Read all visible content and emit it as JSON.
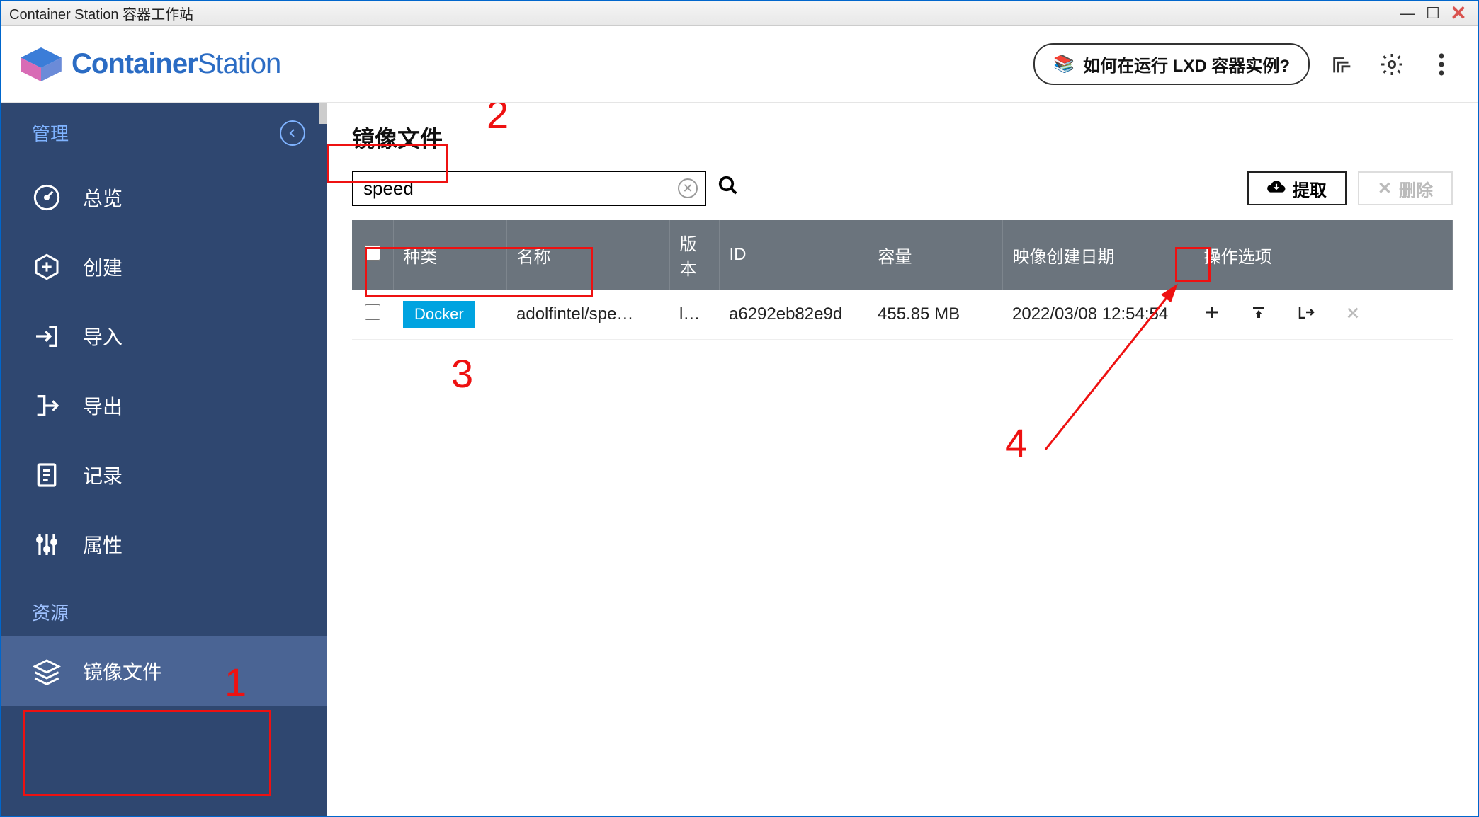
{
  "window": {
    "title": "Container Station 容器工作站"
  },
  "brand": {
    "name_bold": "Container",
    "name_thin": "Station"
  },
  "header": {
    "howto": "如何在运行 LXD 容器实例?"
  },
  "sidebar": {
    "section_manage": "管理",
    "section_resource": "资源",
    "items": {
      "overview": "总览",
      "create": "创建",
      "import": "导入",
      "export": "导出",
      "log": "记录",
      "properties": "属性",
      "images": "镜像文件"
    }
  },
  "page": {
    "title": "镜像文件"
  },
  "search": {
    "value": "speed"
  },
  "buttons": {
    "pull": "提取",
    "delete": "删除"
  },
  "table": {
    "headers": {
      "type": "种类",
      "name": "名称",
      "version": "版本",
      "id": "ID",
      "size": "容量",
      "created": "映像创建日期",
      "actions": "操作选项"
    },
    "rows": [
      {
        "type": "Docker",
        "name": "adolfintel/spe…",
        "version": "l…",
        "id": "a6292eb82e9d",
        "size": "455.85 MB",
        "created": "2022/03/08 12:54:54"
      }
    ]
  },
  "annotations": {
    "n1": "1",
    "n2": "2",
    "n3": "3",
    "n4": "4"
  }
}
